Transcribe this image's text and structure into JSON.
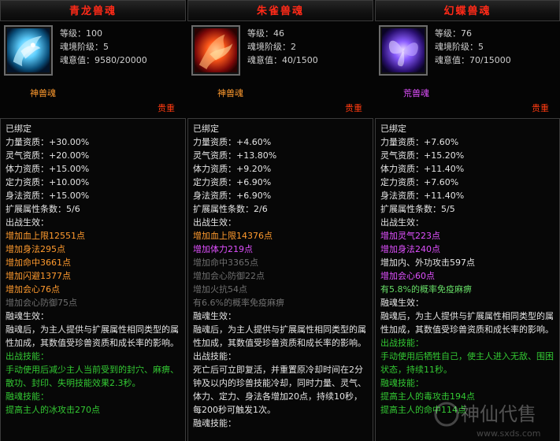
{
  "panels": [
    {
      "title": "青龙兽魂",
      "portrait_icon": "blue-dragon-soul-icon",
      "stats": [
        "等级：100",
        "魂境阶级：5",
        "魂意值：9580/20000"
      ],
      "grade": "神兽魂",
      "grade_color": "#ff9a2e",
      "rarity": "贵重",
      "lines": [
        {
          "t": "已绑定",
          "c": "white"
        },
        {
          "t": "力量资质：+30.00%",
          "c": "white"
        },
        {
          "t": "灵气资质：+20.00%",
          "c": "white"
        },
        {
          "t": "体力资质：+15.00%",
          "c": "white"
        },
        {
          "t": "定力资质：+10.00%",
          "c": "white"
        },
        {
          "t": "身法资质：+15.00%",
          "c": "white"
        },
        {
          "t": "扩展属性条数：5/6",
          "c": "white"
        },
        {
          "t": "出战生效：",
          "c": "white"
        },
        {
          "t": "增加血上限12551点",
          "c": "orange"
        },
        {
          "t": "增加身法295点",
          "c": "orange"
        },
        {
          "t": "增加命中3661点",
          "c": "orange"
        },
        {
          "t": "增加闪避1377点",
          "c": "orange"
        },
        {
          "t": "增加会心76点",
          "c": "orange"
        },
        {
          "t": "增加会心防御75点",
          "c": "gray"
        },
        {
          "t": "融魂生效：",
          "c": "white"
        },
        {
          "t": "融魂后，为主人提供与扩展属性相同类型的属性加成，其数值受珍兽资质和成长率的影响。",
          "c": "white",
          "wrap": true
        },
        {
          "t": "出战技能：",
          "c": "green"
        },
        {
          "t": "手动使用后减少主人当前受到的封穴、麻痹、散功、封印、失明技能效果2.3秒。",
          "c": "green",
          "wrap": true
        },
        {
          "t": "融魂技能：",
          "c": "green"
        },
        {
          "t": "提高主人的冰攻击270点",
          "c": "green"
        }
      ]
    },
    {
      "title": "朱雀兽魂",
      "portrait_icon": "vermilion-bird-soul-icon",
      "stats": [
        "等级：46",
        "魂境阶级：2",
        "魂意值：40/1500"
      ],
      "grade": "神兽魂",
      "grade_color": "#ff9a2e",
      "rarity": "贵重",
      "lines": [
        {
          "t": "已绑定",
          "c": "white"
        },
        {
          "t": "力量资质：+4.60%",
          "c": "white"
        },
        {
          "t": "灵气资质：+13.80%",
          "c": "white"
        },
        {
          "t": "体力资质：+9.20%",
          "c": "white"
        },
        {
          "t": "定力资质：+6.90%",
          "c": "white"
        },
        {
          "t": "身法资质：+6.90%",
          "c": "white"
        },
        {
          "t": "扩展属性条数：2/6",
          "c": "white"
        },
        {
          "t": "出战生效：",
          "c": "white"
        },
        {
          "t": "增加血上限14376点",
          "c": "orange"
        },
        {
          "t": "增加体力219点",
          "c": "magenta"
        },
        {
          "t": "增加命中3365点",
          "c": "gray"
        },
        {
          "t": "增加会心防御22点",
          "c": "gray"
        },
        {
          "t": "增加火抗54点",
          "c": "gray"
        },
        {
          "t": "有6.6%的概率免疫麻痹",
          "c": "gray"
        },
        {
          "t": "融魂生效：",
          "c": "white"
        },
        {
          "t": "融魂后，为主人提供与扩展属性相同类型的属性加成，其数值受珍兽资质和成长率的影响。",
          "c": "white",
          "wrap": true
        },
        {
          "t": "出战技能：",
          "c": "white"
        },
        {
          "t": "死亡后可立即复活，并重置原冷却时间在2分钟及以内的珍兽技能冷却，同时力量、灵气、体力、定力、身法各增加20点，持续10秒，每200秒可触发1次。",
          "c": "white",
          "wrap": true
        },
        {
          "t": "融魂技能：",
          "c": "white"
        }
      ]
    },
    {
      "title": "幻蝶兽魂",
      "portrait_icon": "phantom-butterfly-soul-icon",
      "stats": [
        "等级：76",
        "魂境阶级：5",
        "魂意值：70/15000"
      ],
      "grade": "荒兽魂",
      "grade_color": "#e050ff",
      "rarity": "贵重",
      "lines": [
        {
          "t": "已绑定",
          "c": "white"
        },
        {
          "t": "力量资质：+7.60%",
          "c": "white"
        },
        {
          "t": "灵气资质：+15.20%",
          "c": "white"
        },
        {
          "t": "体力资质：+11.40%",
          "c": "white"
        },
        {
          "t": "定力资质：+7.60%",
          "c": "white"
        },
        {
          "t": "身法资质：+11.40%",
          "c": "white"
        },
        {
          "t": "扩展属性条数：5/5",
          "c": "white"
        },
        {
          "t": "出战生效：",
          "c": "white"
        },
        {
          "t": "增加灵气223点",
          "c": "magenta"
        },
        {
          "t": "增加身法240点",
          "c": "magenta"
        },
        {
          "t": "增加内、外功攻击597点",
          "c": "white"
        },
        {
          "t": "增加会心60点",
          "c": "magenta"
        },
        {
          "t": "有5.8%的概率免疫麻痹",
          "c": "ltgreen"
        },
        {
          "t": "融魂生效：",
          "c": "white"
        },
        {
          "t": "融魂后，为主人提供与扩展属性相同类型的属性加成，其数值受珍兽资质和成长率的影响。",
          "c": "white",
          "wrap": true
        },
        {
          "t": "出战技能：",
          "c": "green"
        },
        {
          "t": "手动使用后牺牲自己，使主人进入无敌、围困状态，持续11秒。",
          "c": "green",
          "wrap": true
        },
        {
          "t": "融魂技能：",
          "c": "green"
        },
        {
          "t": "提高主人的毒攻击194点",
          "c": "green"
        },
        {
          "t": "提高主人的命中114点",
          "c": "green"
        }
      ]
    }
  ],
  "watermark": {
    "text": "神仙代售",
    "url_text": "www.sxds.com"
  }
}
